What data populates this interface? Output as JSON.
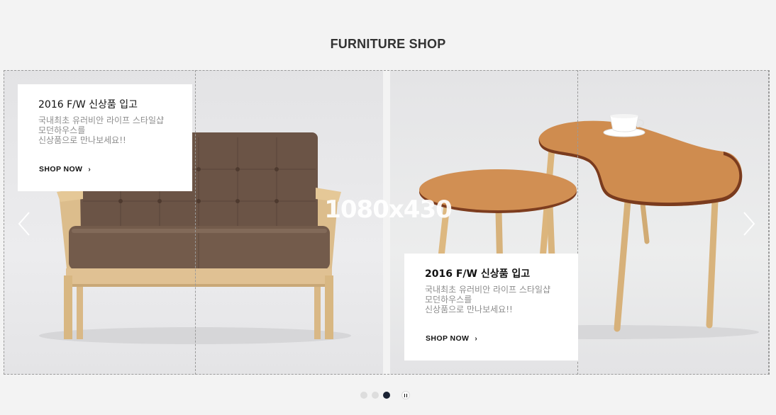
{
  "page": {
    "heading": "FURNITURE SHOP"
  },
  "slider": {
    "watermark": "1080x430",
    "slides": [
      {
        "image": "brown-upholstered-loveseat",
        "title": "2016 F/W 신상품 입고",
        "text": "국내최초 유러비안 라이프 스타일샵\n모던하우스를\n신상품으로 만나보세요!!",
        "link_label": "SHOP NOW",
        "link_icon": "chevron-right-icon"
      },
      {
        "image": "wooden-nesting-tables-with-teacup",
        "title": "2016 F/W 신상품 입고",
        "text": "국내최초 유러비안 라이프 스타일샵\n모던하우스를\n신상품으로 만나보세요!!",
        "link_label": "SHOP NOW",
        "link_icon": "chevron-right-icon"
      }
    ],
    "prev_icon": "chevron-left-icon",
    "next_icon": "chevron-right-icon",
    "pagination": {
      "count": 3,
      "active_index": 2,
      "pause_icon": "pause-icon"
    }
  },
  "colors": {
    "background": "#f3f3f3",
    "heading": "#333333",
    "active_dot": "#1a2233",
    "inactive_dot": "#dddddd"
  }
}
